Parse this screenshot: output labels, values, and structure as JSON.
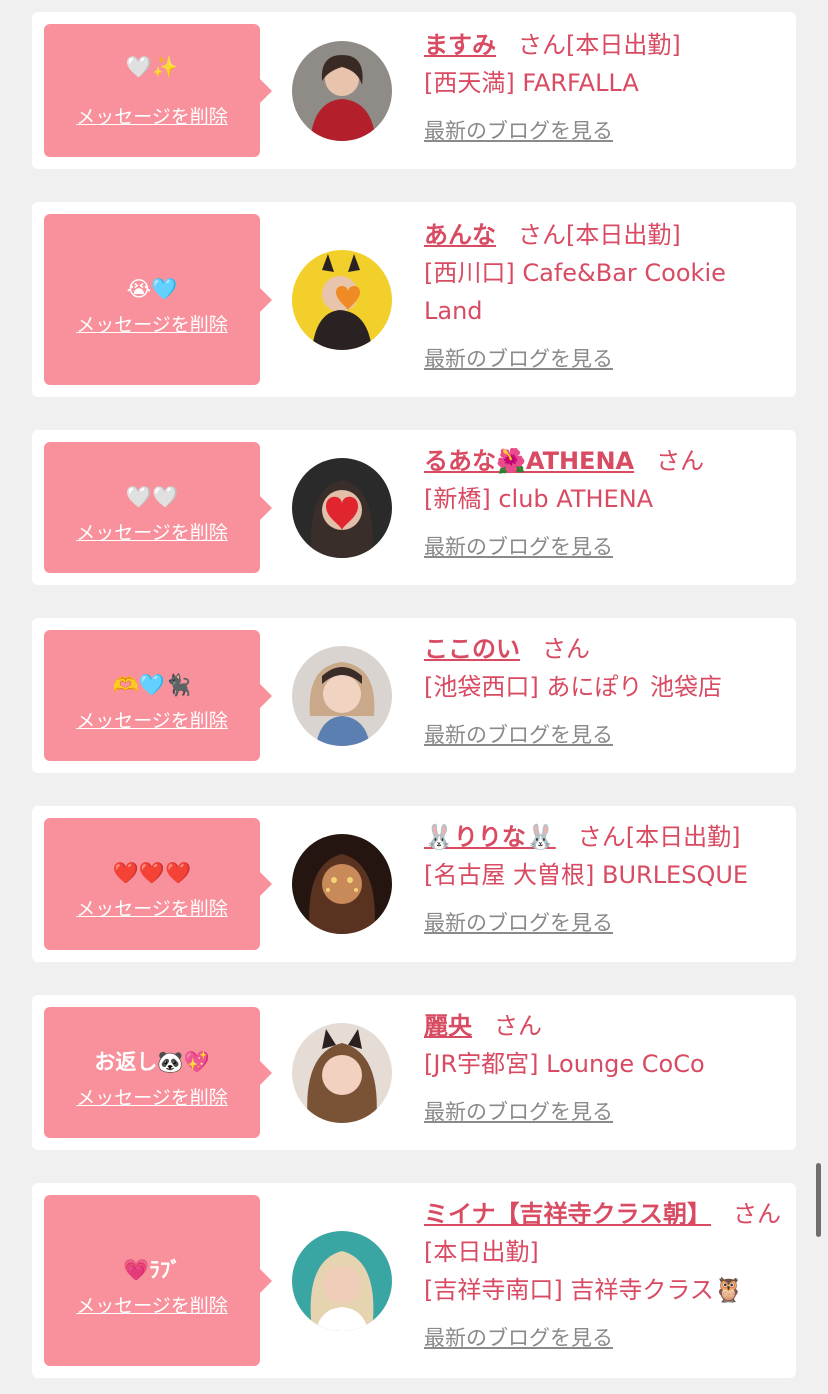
{
  "colors": {
    "page_bg": "#f0f0f0",
    "card_bg": "#ffffff",
    "bubble_bg": "#f9919c",
    "accent_text": "#d84b62",
    "link_gray": "#8a8a8a"
  },
  "cards": [
    {
      "message": "🤍✨",
      "delete_label": "メッセージを削除",
      "name": "ますみ",
      "san": "さん[本日出勤]",
      "shop": "[西天満] FARFALLA",
      "blog_link": "最新のブログを見る",
      "avatar_icon": "profile-photo"
    },
    {
      "message": "😭🩵",
      "delete_label": "メッセージを削除",
      "name": "あんな",
      "san": "さん[本日出勤]",
      "shop": "[西川口] Cafe&Bar Cookie Land",
      "blog_link": "最新のブログを見る",
      "avatar_icon": "profile-photo"
    },
    {
      "message": "🤍🤍",
      "delete_label": "メッセージを削除",
      "name": "るあな🌺ATHENA",
      "san": "さん",
      "shop": "[新橋] club ATHENA",
      "blog_link": "最新のブログを見る",
      "avatar_icon": "profile-photo"
    },
    {
      "message": "🫶🩵🐈‍⬛",
      "delete_label": "メッセージを削除",
      "name": "ここのい",
      "san": "さん",
      "shop": "[池袋西口] あにぽり 池袋店",
      "blog_link": "最新のブログを見る",
      "avatar_icon": "profile-photo"
    },
    {
      "message": "❤️❤️❤️",
      "delete_label": "メッセージを削除",
      "name": "🐰りりな🐰",
      "san": "さん[本日出勤]",
      "shop": "[名古屋 大曽根] BURLESQUE",
      "blog_link": "最新のブログを見る",
      "avatar_icon": "profile-photo"
    },
    {
      "message": "お返し🐼💖",
      "delete_label": "メッセージを削除",
      "name": "麗央",
      "san": "さん",
      "shop": "[JR宇都宮] Lounge CoCo",
      "blog_link": "最新のブログを見る",
      "avatar_icon": "profile-photo"
    },
    {
      "message": "💗ﾗﾌﾞ",
      "delete_label": "メッセージを削除",
      "name": "ミイナ【吉祥寺クラス朝】",
      "san": "さん[本日出勤]",
      "shop": "[吉祥寺南口] 吉祥寺クラス🦉",
      "blog_link": "最新のブログを見る",
      "avatar_icon": "profile-photo"
    }
  ]
}
